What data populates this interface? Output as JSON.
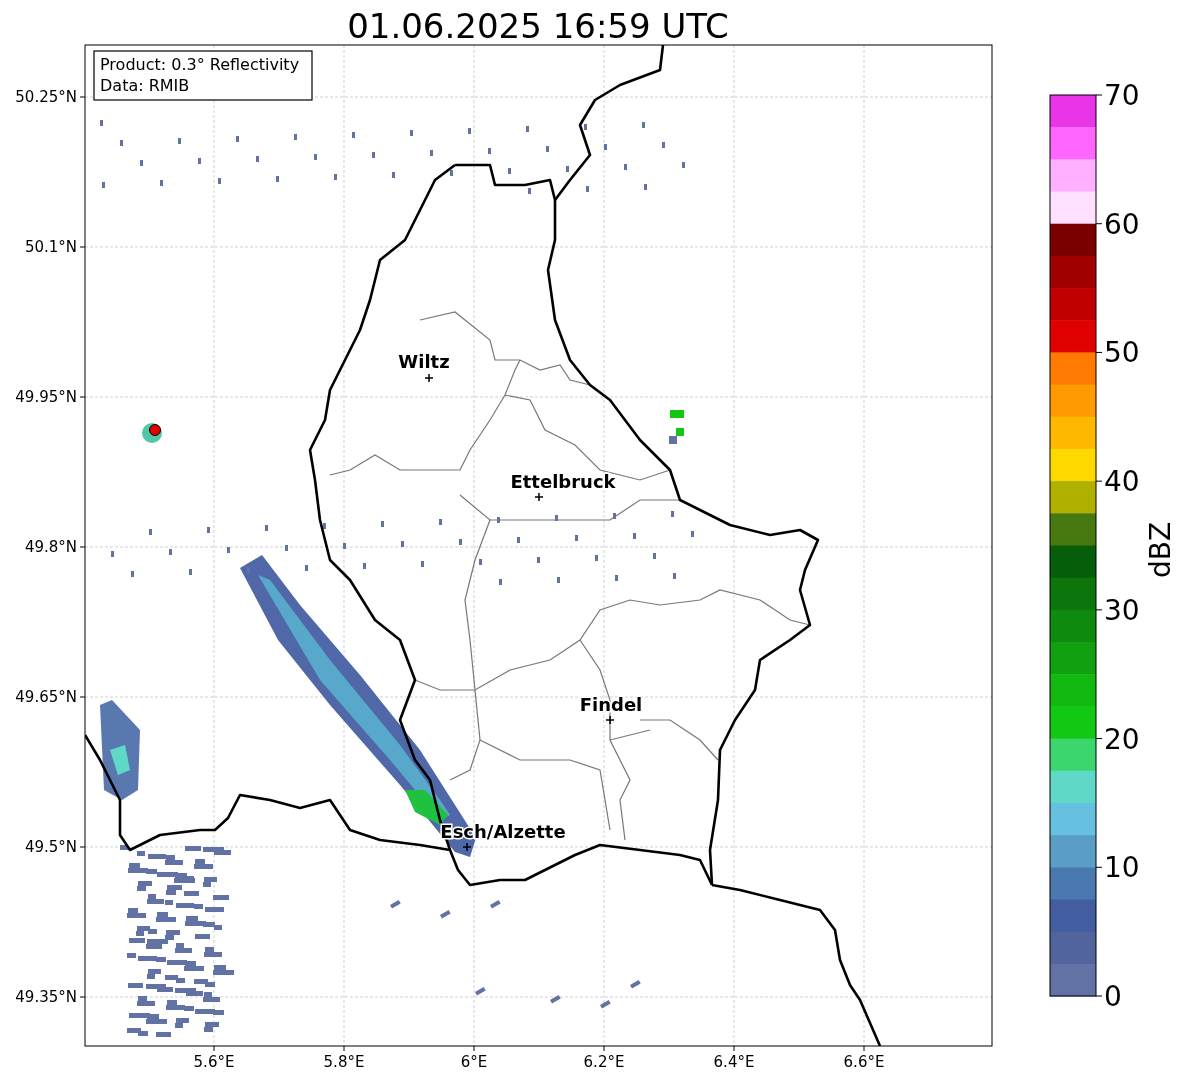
{
  "title": "01.06.2025 16:59 UTC",
  "info_box": [
    "Product: 0.3° Reflectivity",
    "Data: RMIB"
  ],
  "map": {
    "lon_ticks": [
      "5.6°E",
      "5.8°E",
      "6°E",
      "6.2°E",
      "6.4°E",
      "6.6°E"
    ],
    "lat_ticks": [
      "50.25°N",
      "50.1°N",
      "49.95°N",
      "49.8°N",
      "49.65°N",
      "49.5°N",
      "49.35°N"
    ],
    "places": [
      {
        "name": "Wiltz"
      },
      {
        "name": "Ettelbruck"
      },
      {
        "name": "Findel"
      },
      {
        "name": "Esch/Alzette"
      }
    ]
  },
  "colorbar": {
    "label": "dBZ",
    "ticks": [
      "70",
      "60",
      "50",
      "40",
      "30",
      "20",
      "10",
      "0"
    ],
    "segments": [
      {
        "color": "#e835e8"
      },
      {
        "color": "#ff66ff"
      },
      {
        "color": "#ffb0ff"
      },
      {
        "color": "#ffe0ff"
      },
      {
        "color": "#7a0000"
      },
      {
        "color": "#a00000"
      },
      {
        "color": "#c00000"
      },
      {
        "color": "#e00000"
      },
      {
        "color": "#ff7a00"
      },
      {
        "color": "#ff9a00"
      },
      {
        "color": "#ffb800"
      },
      {
        "color": "#ffd800"
      },
      {
        "color": "#b0b000"
      },
      {
        "color": "#487810"
      },
      {
        "color": "#065e0a"
      },
      {
        "color": "#0c760c"
      },
      {
        "color": "#0e8a0e"
      },
      {
        "color": "#10a010"
      },
      {
        "color": "#10b810"
      },
      {
        "color": "#12c812"
      },
      {
        "color": "#3cd66e"
      },
      {
        "color": "#60d8c8"
      },
      {
        "color": "#66c0e0"
      },
      {
        "color": "#5a9ec8"
      },
      {
        "color": "#4a78b0"
      },
      {
        "color": "#425ea0"
      },
      {
        "color": "#52649c"
      },
      {
        "color": "#6272a4"
      }
    ]
  }
}
